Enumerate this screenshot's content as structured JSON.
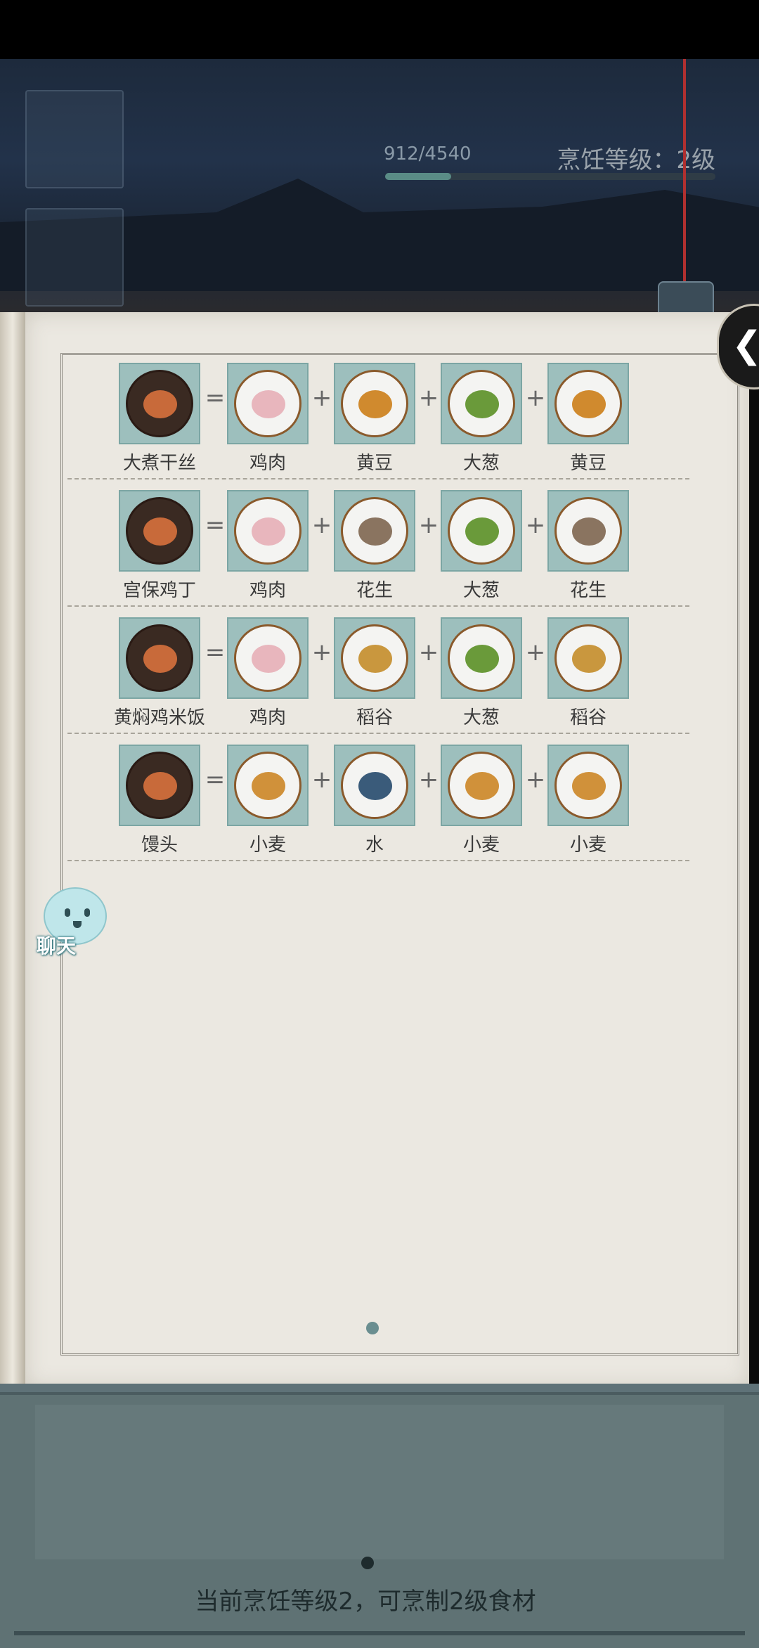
{
  "status_bar": {},
  "hud": {
    "xp_text": "912/4540",
    "xp_progress": 0.2,
    "cooking_level": "烹饪等级：2级"
  },
  "recipes": [
    {
      "dish": "大煮干丝",
      "ingredients": [
        "鸡肉",
        "黄豆",
        "大葱",
        "黄豆"
      ]
    },
    {
      "dish": "宫保鸡丁",
      "ingredients": [
        "鸡肉",
        "花生",
        "大葱",
        "花生"
      ]
    },
    {
      "dish": "黄焖鸡米饭",
      "ingredients": [
        "鸡肉",
        "稻谷",
        "大葱",
        "稻谷"
      ]
    },
    {
      "dish": "馒头",
      "ingredients": [
        "小麦",
        "水",
        "小麦",
        "小麦"
      ]
    }
  ],
  "operators": {
    "equals": "=",
    "plus": "+"
  },
  "chat": {
    "label": "聊天"
  },
  "bottom": {
    "message": "当前烹饪等级2，可烹制2级食材"
  },
  "colors": {
    "accent": "#5a8c86",
    "page": "#ebe8e1",
    "panel": "#5f7274",
    "icon_bg": "#9dbfbd"
  },
  "icons": {
    "collapse": "chevron-left-icon"
  }
}
